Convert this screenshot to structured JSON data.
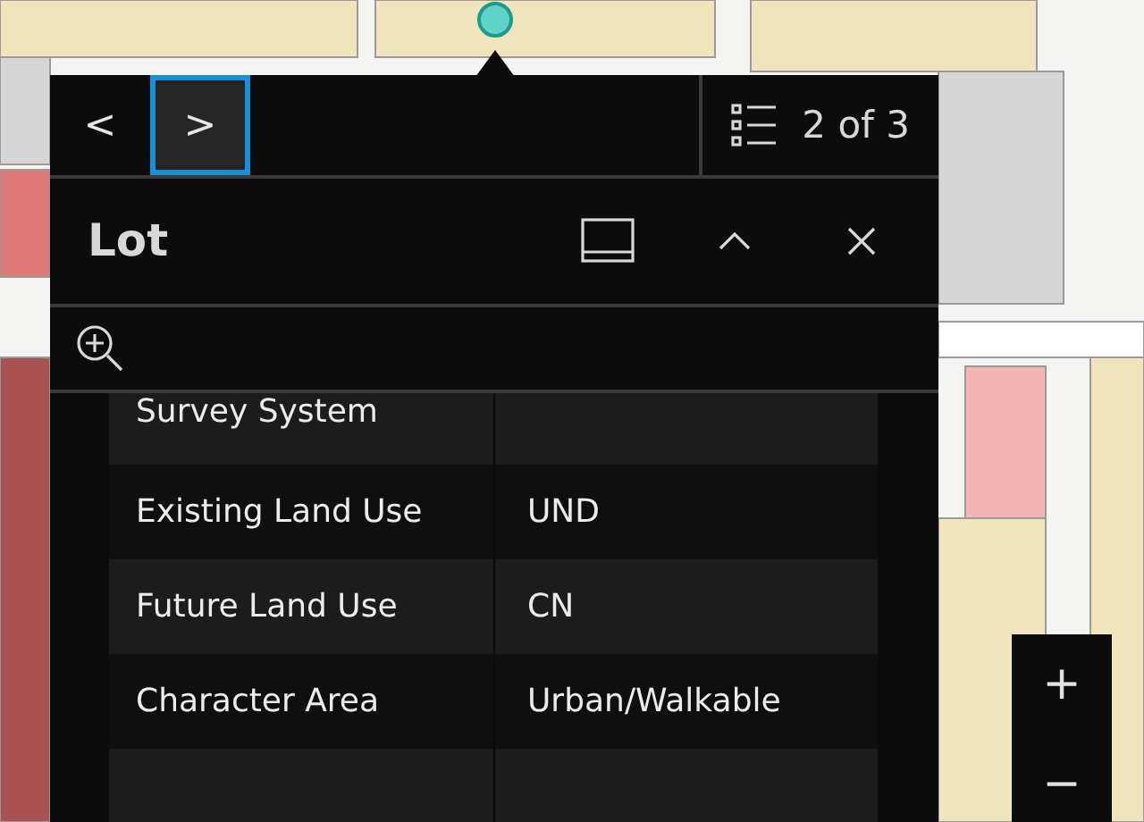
{
  "popup": {
    "nav": {
      "previous_label": "<",
      "next_label": ">",
      "next_focused": true,
      "counter": "2 of 3"
    },
    "title": "Lot",
    "fields": [
      {
        "label": "Survey System"
      },
      {
        "label": "Existing Land Use",
        "value": "UND"
      },
      {
        "label": "Future Land Use",
        "value": "CN"
      },
      {
        "label": "Character Area",
        "value": "Urban/Walkable"
      }
    ]
  },
  "zoom_controls": [
    "+",
    "−"
  ]
}
